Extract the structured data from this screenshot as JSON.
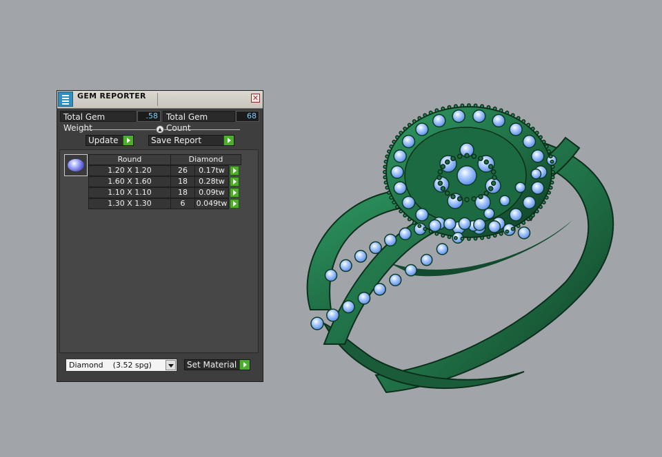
{
  "panel": {
    "title": "GEM REPORTER",
    "close_glyph": "✕",
    "total_weight_label": "Total Gem Weight",
    "total_weight_value": ".58",
    "total_count_label": "Total Gem Count",
    "total_count_value": "68",
    "update_label": "Update",
    "save_report_label": "Save Report",
    "table": {
      "col_shape": "Round",
      "col_material": "Diamond",
      "rows": [
        {
          "size": "1.20 X 1.20",
          "count": "26",
          "weight": "0.17tw"
        },
        {
          "size": "1.60 X 1.60",
          "count": "18",
          "weight": "0.28tw"
        },
        {
          "size": "1.10 X 1.10",
          "count": "18",
          "weight": "0.09tw"
        },
        {
          "size": "1.30 X 1.30",
          "count": "6",
          "weight": "0.049tw"
        }
      ]
    },
    "material_select_value": "Diamond    (3.52 spg)",
    "set_material_label": "Set Material"
  },
  "icons": {
    "app": "gem-reporter-app-icon",
    "close": "close-icon",
    "go": "green-arrow-icon",
    "dropdown": "chevron-down-icon",
    "gem": "round-gem-icon"
  },
  "colors": {
    "viewport_bg": "#a1a5aa",
    "ring_metal": "#1f6e45",
    "gem_stone": "#8cb8ff",
    "accent_green": "#4caf2a",
    "value_text": "#7fd0ff"
  }
}
